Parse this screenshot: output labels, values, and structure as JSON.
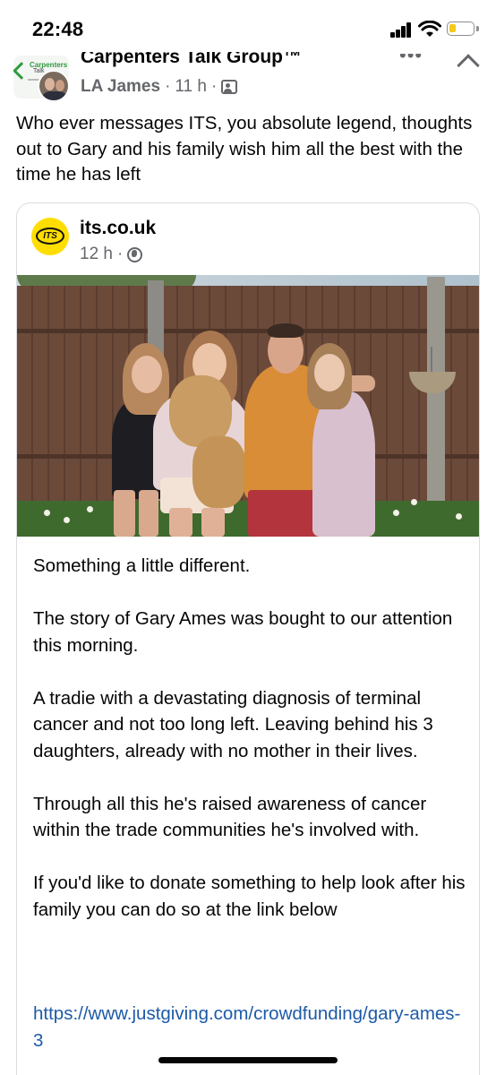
{
  "status_bar": {
    "time": "22:48",
    "signal_icon": "cellular-signal-icon",
    "wifi_icon": "wifi-icon",
    "battery_icon": "battery-low-icon",
    "battery_level": 0.25,
    "battery_color": "#f5c918"
  },
  "post": {
    "group_name": "Carpenters Talk Group™",
    "group_logo_text": "Carpenters",
    "group_logo_subtext": "Talk",
    "author": "LA James",
    "time_ago": "11 h",
    "separator": "·",
    "audience_icon": "group-members-icon",
    "more_icon": "more-options-icon",
    "collapse_icon": "chevron-up-icon",
    "text": "Who ever messages ITS, you absolute legend, thoughts out to Gary and his family wish him all the best with the time he has left"
  },
  "shared_post": {
    "page_name": "its.co.uk",
    "page_logo_text": "ITS",
    "time_ago": "12 h",
    "separator": "·",
    "privacy_icon": "globe-icon",
    "brand_color": "#ffdd00",
    "paragraphs": [
      "Something a little different.",
      "The story of Gary Ames was bought to our attention this morning.",
      "A tradie with a devastating diagnosis of terminal cancer and not too long left. Leaving behind his 3 daughters, already with no mother in their lives.",
      "Through all this he's raised awareness of cancer within the trade communities he's involved with.",
      "If you'd like to donate something to help look after his family you can do so at the link below"
    ],
    "link": "https://www.justgiving.com/crowdfunding/gary-ames-3",
    "link_color": "#1d5aa8"
  }
}
